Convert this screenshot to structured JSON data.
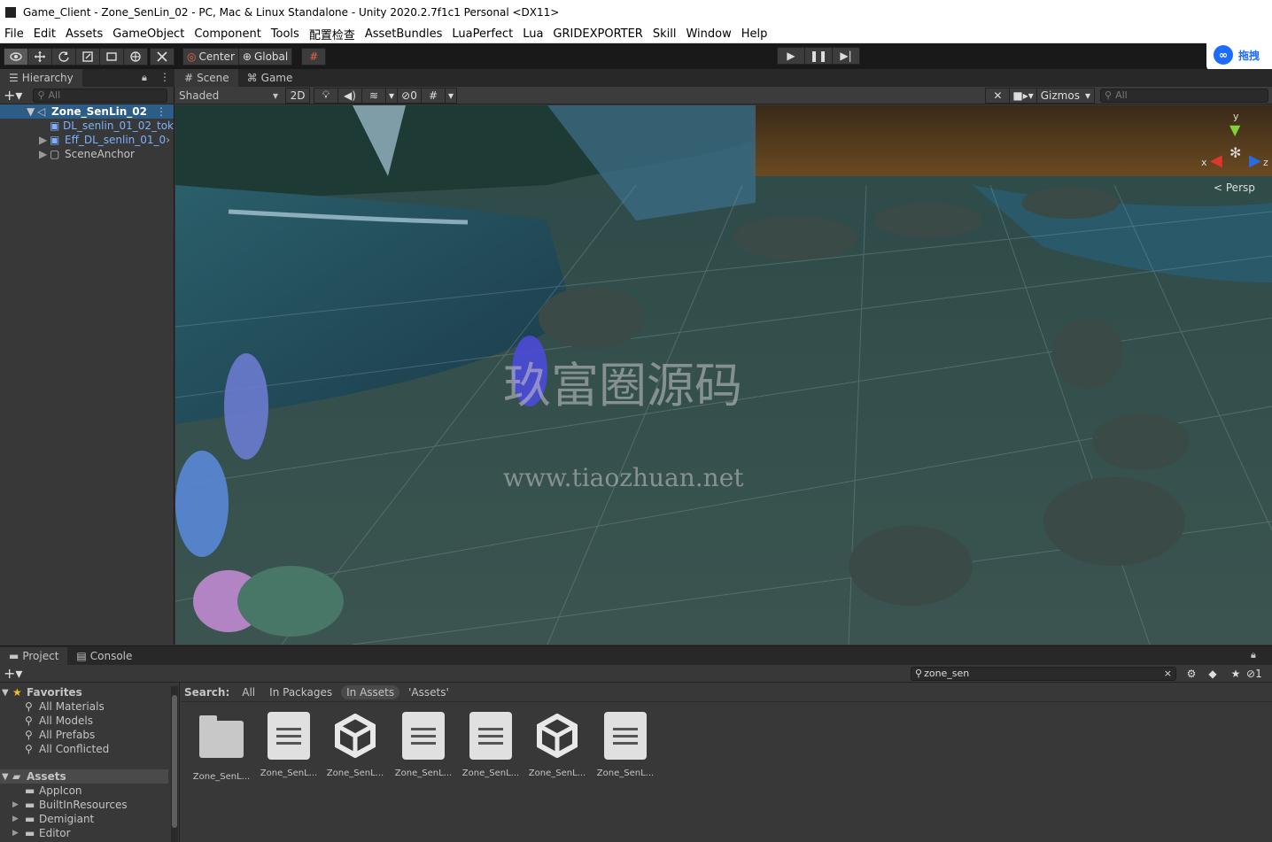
{
  "window": {
    "title": "Game_Client - Zone_SenLin_02 - PC, Mac & Linux Standalone - Unity 2020.2.7f1c1 Personal <DX11>"
  },
  "menu": [
    "File",
    "Edit",
    "Assets",
    "GameObject",
    "Component",
    "Tools",
    "配置检查",
    "AssetBundles",
    "LuaPerfect",
    "Lua",
    "GRIDEXPORTER",
    "Skill",
    "Window",
    "Help"
  ],
  "toolbar": {
    "center_label": "Center",
    "global_label": "Global"
  },
  "overlay": {
    "baidu_label": "拖拽"
  },
  "hierarchy": {
    "tab": "Hierarchy",
    "search_placeholder": "All",
    "scene": "Zone_SenLin_02",
    "items": [
      "DL_senlin_01_02_tok",
      "Eff_DL_senlin_01_0",
      "SceneAnchor"
    ]
  },
  "scene": {
    "tabs": [
      "Scene",
      "Game"
    ],
    "shading": "Shaded",
    "mode_2d": "2D",
    "hidden_count": "0",
    "gizmos": "Gizmos",
    "search_placeholder": "All",
    "persp": "Persp",
    "axis_y": "y",
    "axis_x": "x",
    "axis_z": "z"
  },
  "watermark": {
    "line1": "玖富圈源码",
    "line2": "www.tiaozhuan.net"
  },
  "project": {
    "tabs": [
      "Project",
      "Console"
    ],
    "search_value": "zone_sen",
    "hidden_count": "1",
    "search_label": "Search:",
    "filters": [
      "All",
      "In Packages",
      "In Assets",
      "'Assets'"
    ],
    "favorites_label": "Favorites",
    "favorites": [
      "All Materials",
      "All Models",
      "All Prefabs",
      "All Conflicted"
    ],
    "assets_label": "Assets",
    "folders": [
      "AppIcon",
      "BuiltInResources",
      "Demigiant",
      "Editor"
    ],
    "results": [
      {
        "label": "Zone_SenL...",
        "icon": "folder-icon"
      },
      {
        "label": "Zone_SenL...",
        "icon": "document-icon"
      },
      {
        "label": "Zone_SenL...",
        "icon": "unity-scene-icon"
      },
      {
        "label": "Zone_SenL...",
        "icon": "document-icon"
      },
      {
        "label": "Zone_SenL...",
        "icon": "document-icon"
      },
      {
        "label": "Zone_SenL...",
        "icon": "unity-scene-icon"
      },
      {
        "label": "Zone_SenL...",
        "icon": "document-icon"
      }
    ]
  }
}
